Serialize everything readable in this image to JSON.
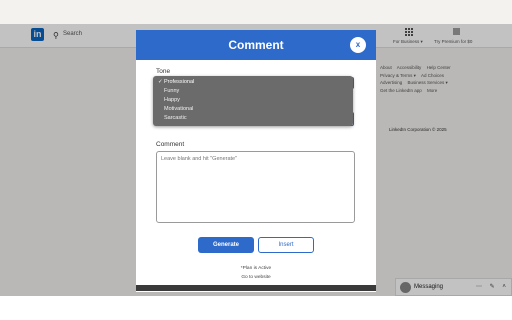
{
  "background": {
    "logo_text": "in",
    "search_placeholder": "Search",
    "for_business": "For Business ▾",
    "premium": "Try Premium for $0",
    "right_links": [
      "About",
      "Accessibility",
      "Help Center",
      "Privacy & Terms ▾",
      "Ad Choices",
      "Advertising",
      "Business Services ▾",
      "Get the LinkedIn app",
      "More"
    ],
    "copyright": "LinkedIn Corporation © 2025",
    "messaging": "Messaging",
    "messaging_icons": "⋯ ✎ ˄"
  },
  "modal": {
    "title": "Comment",
    "close_label": "x",
    "tone_label": "Tone",
    "tone_options": [
      "Professional",
      "Funny",
      "Happy",
      "Motivational",
      "Sarcastic"
    ],
    "tone_selected": "Professional",
    "comment_label": "Comment",
    "comment_placeholder": "Leave blank and hit \"Generate\"",
    "generate_label": "Generate",
    "insert_label": "Insert",
    "plan_status": "*Plan is Active",
    "website_link": "Go to website"
  },
  "colors": {
    "accent": "#2e6ac9",
    "dropdown_bg": "#6b6b6b",
    "linkedin_blue": "#0a66c2"
  }
}
